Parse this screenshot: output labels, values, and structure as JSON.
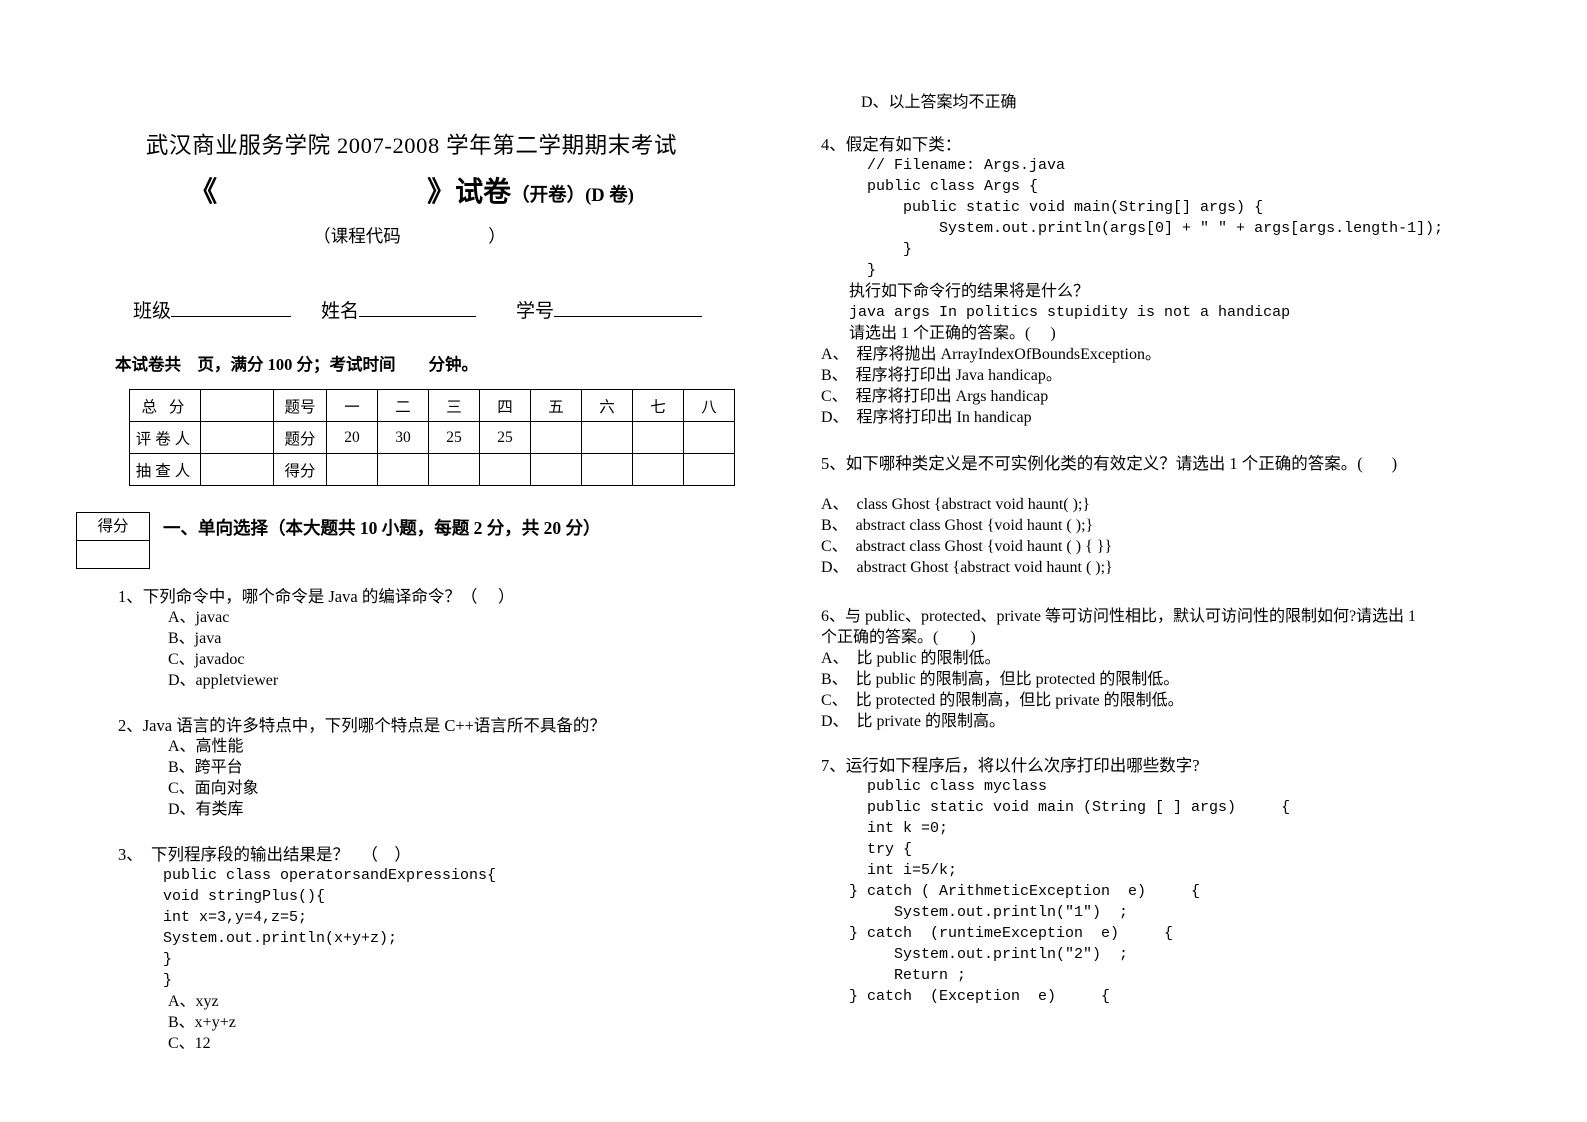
{
  "header": {
    "line1": "武汉商业服务学院 2007-2008 学年第二学期期末考试",
    "title_main": "《                              》试卷",
    "title_suffix": "（开卷）(D 卷)",
    "course_code": "（课程代码                    ）"
  },
  "identity": {
    "class_label": "班级",
    "name_label": "姓名",
    "student_no_label": "学号"
  },
  "notice": "本试卷共    页，满分 100 分；考试时间        分钟。",
  "score_table": {
    "rows": [
      [
        "总  分",
        "",
        "题号",
        "一",
        "二",
        "三",
        "四",
        "五",
        "六",
        "七",
        "八"
      ],
      [
        "评卷人",
        "",
        "题分",
        "20",
        "30",
        "25",
        "25",
        "",
        "",
        "",
        ""
      ],
      [
        "抽查人",
        "",
        "得分",
        "",
        "",
        "",
        "",
        "",
        "",
        "",
        ""
      ]
    ]
  },
  "section": {
    "defen_label": "得分",
    "title": "一、单向选择（本大题共 10 小题，每题 2 分，共 20 分）"
  },
  "left_column": {
    "questions": [
      {
        "stem": "1、下列命令中，哪个命令是 Java 的编译命令？（     ）",
        "options": [
          "A、javac",
          "B、java",
          "C、javadoc",
          "D、appletviewer"
        ]
      },
      {
        "stem": "2、Java 语言的许多特点中，下列哪个特点是 C++语言所不具备的？",
        "options": [
          "A、高性能",
          "B、跨平台",
          "C、面向对象",
          "D、有类库"
        ]
      },
      {
        "stem": "3、  下列程序段的输出结果是？   （    ）",
        "code": [
          "public class operatorsandExpressions{",
          "void stringPlus(){",
          "int x=3,y=4,z=5;",
          "System.out.println(x+y+z);",
          "}",
          "}"
        ],
        "options": [
          "A、xyz",
          "B、x+y+z",
          "C、12"
        ]
      }
    ]
  },
  "right_column": {
    "orphan_option": "D、以上答案均不正确",
    "questions": [
      {
        "stem": "4、假定有如下类：",
        "code": [
          "// Filename: Args.java",
          "public class Args {",
          "    public static void main(String[] args) {",
          "        System.out.println(args[0] + \" \" + args[args.length-1]);",
          "    }",
          "}"
        ],
        "followup": [
          "执行如下命令行的结果将是什么？",
          "java args In politics stupidity is not a handicap",
          "请选出 1 个正确的答案。(     )"
        ],
        "options": [
          "A、  程序将抛出 ArrayIndexOfBoundsException。",
          "B、  程序将打印出 Java handicap。",
          "C、  程序将打印出 Args handicap",
          "D、  程序将打印出 In handicap"
        ]
      },
      {
        "stem": "5、如下哪种类定义是不可实例化类的有效定义？请选出 1 个正确的答案。(       )",
        "options": [
          "A、  class Ghost {abstract void haunt( );}",
          "B、  abstract class Ghost {void haunt ( );}",
          "C、  abstract class Ghost {void haunt ( ) { }}",
          "D、  abstract Ghost {abstract void haunt ( );}"
        ]
      },
      {
        "stem": "6、与 public、protected、private 等可访问性相比，默认可访问性的限制如何?请选出 1\n个正确的答案。(        )",
        "options": [
          "A、  比 public 的限制低。",
          "B、  比 public 的限制高，但比 protected 的限制低。",
          "C、  比 protected 的限制高，但比 private 的限制低。",
          "D、  比 private 的限制高。"
        ]
      },
      {
        "stem": "7、运行如下程序后，将以什么次序打印出哪些数字?",
        "code": [
          "public class myclass",
          "public static void main (String [ ] args)     {",
          "int k =0;",
          "try {",
          "int i=5/k;",
          "} catch ( ArithmeticException  e)     {",
          "     System.out.println(\"1\")  ;",
          "} catch  (runtimeException  e)     {",
          "     System.out.println(\"2\")  ;",
          "     Return ;",
          "} catch  (Exception  e)     {"
        ]
      }
    ]
  }
}
